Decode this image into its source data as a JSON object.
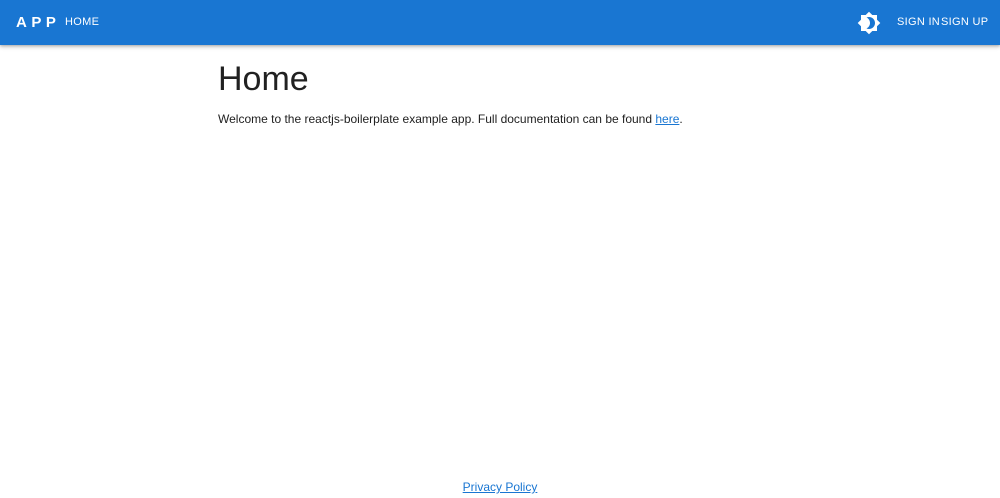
{
  "header": {
    "brand": "APP",
    "nav_home": "HOME",
    "theme_toggle_icon": "brightness-icon",
    "sign_in": "SIGN IN",
    "sign_up": "SIGN UP"
  },
  "main": {
    "title": "Home",
    "intro_text": "Welcome to the reactjs-boilerplate example app. Full documentation can be found ",
    "intro_link": "here",
    "intro_suffix": "."
  },
  "footer": {
    "privacy_link": "Privacy Policy"
  },
  "colors": {
    "appbar": "#1976d2",
    "link": "#1976d2",
    "text": "#212121",
    "background": "#ffffff"
  }
}
